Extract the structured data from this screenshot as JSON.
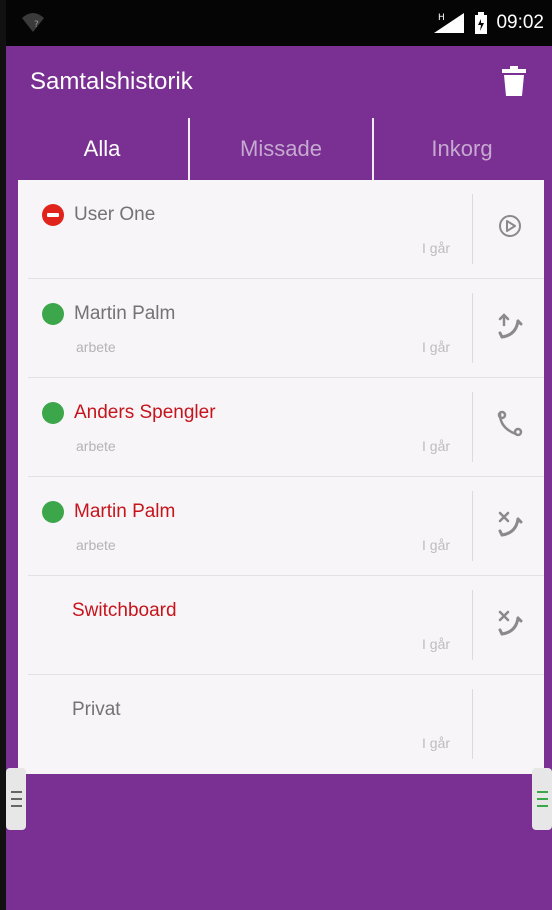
{
  "status_bar": {
    "time": "09:02",
    "signal_label": "H"
  },
  "app_bar": {
    "title": "Samtalshistorik"
  },
  "tabs": [
    {
      "label": "Alla",
      "selected": true
    },
    {
      "label": "Missade",
      "selected": false
    },
    {
      "label": "Inkorg",
      "selected": false
    }
  ],
  "calls": [
    {
      "name": "User One",
      "sub": "",
      "date": "I går",
      "status": "busy",
      "missed": false,
      "action": "play-icon"
    },
    {
      "name": "Martin Palm",
      "sub": "arbete",
      "date": "I går",
      "status": "available",
      "missed": false,
      "action": "outgoing-call-icon"
    },
    {
      "name": "Anders Spengler",
      "sub": "arbete",
      "date": "I går",
      "status": "available",
      "missed": true,
      "action": "phone-icon"
    },
    {
      "name": "Martin Palm",
      "sub": "arbete",
      "date": "I går",
      "status": "available",
      "missed": true,
      "action": "missed-call-icon"
    },
    {
      "name": "Switchboard",
      "sub": "",
      "date": "I går",
      "status": "",
      "missed": true,
      "action": "missed-call-icon"
    },
    {
      "name": "Privat",
      "sub": "",
      "date": "I går",
      "status": "",
      "missed": false,
      "action": ""
    }
  ],
  "colors": {
    "primary": "#7a2f92",
    "missed": "#c6141c",
    "available": "#3ba64a",
    "busy": "#e0241c"
  }
}
